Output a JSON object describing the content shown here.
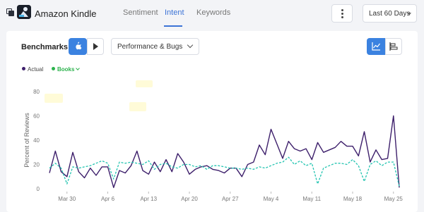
{
  "header": {
    "app_name": "Amazon Kindle",
    "tabs": [
      {
        "label": "Sentiment",
        "active": false
      },
      {
        "label": "Intent",
        "active": true
      },
      {
        "label": "Keywords",
        "active": false
      }
    ],
    "date_range": "Last 60 Days"
  },
  "toolbar": {
    "title": "Benchmarks",
    "category": "Performance & Bugs"
  },
  "legend": {
    "actual": "Actual",
    "books": "Books"
  },
  "colors": {
    "accent": "#3b73d6",
    "button_active": "#3b82e0",
    "actual_series": "#3d1f6b",
    "books_series": "#22c4b0",
    "books_legend": "#2bb24c"
  },
  "chart_data": {
    "type": "line",
    "ylabel": "Percent of Reviews",
    "ylim": [
      0,
      80
    ],
    "yticks": [
      0,
      20,
      40,
      60,
      80
    ],
    "grid": false,
    "x_tick_labels": [
      "Mar 30",
      "Apr 6",
      "Apr 13",
      "Apr 20",
      "Apr 27",
      "May 4",
      "May 11",
      "May 18",
      "May 25"
    ],
    "x": [
      "Mar 27",
      "Mar 28",
      "Mar 29",
      "Mar 30",
      "Mar 31",
      "Apr 1",
      "Apr 2",
      "Apr 3",
      "Apr 4",
      "Apr 5",
      "Apr 6",
      "Apr 7",
      "Apr 8",
      "Apr 9",
      "Apr 10",
      "Apr 11",
      "Apr 12",
      "Apr 13",
      "Apr 14",
      "Apr 15",
      "Apr 16",
      "Apr 17",
      "Apr 18",
      "Apr 19",
      "Apr 20",
      "Apr 21",
      "Apr 22",
      "Apr 23",
      "Apr 24",
      "Apr 25",
      "Apr 26",
      "Apr 27",
      "Apr 28",
      "Apr 29",
      "Apr 30",
      "May 1",
      "May 2",
      "May 3",
      "May 4",
      "May 5",
      "May 6",
      "May 7",
      "May 8",
      "May 9",
      "May 10",
      "May 11",
      "May 12",
      "May 13",
      "May 14",
      "May 15",
      "May 16",
      "May 17",
      "May 18",
      "May 19",
      "May 20",
      "May 21",
      "May 22",
      "May 23",
      "May 24",
      "May 25",
      "May 26"
    ],
    "series": [
      {
        "name": "Actual",
        "values": [
          13,
          31,
          14,
          10,
          30,
          14,
          9,
          17,
          11,
          18,
          18,
          1,
          15,
          13,
          19,
          31,
          15,
          12,
          22,
          14,
          24,
          14,
          29,
          22,
          12,
          16,
          18,
          19,
          16,
          15,
          13,
          17,
          17,
          10,
          20,
          22,
          36,
          28,
          49,
          37,
          25,
          39,
          33,
          31,
          33,
          24,
          38,
          30,
          32,
          34,
          39,
          35,
          35,
          27,
          47,
          22,
          32,
          24,
          25,
          60,
          1,
          1
        ],
        "color": "#3d1f6b"
      },
      {
        "name": "Books",
        "values": [
          17,
          21,
          17,
          4,
          18,
          17,
          18,
          19,
          21,
          23,
          21,
          8,
          22,
          21,
          22,
          21,
          20,
          23,
          16,
          20,
          21,
          18,
          17,
          20,
          20,
          18,
          19,
          16,
          19,
          19,
          18,
          17,
          17,
          16,
          17,
          16,
          18,
          17,
          19,
          21,
          22,
          26,
          20,
          23,
          19,
          21,
          4,
          17,
          19,
          21,
          21,
          20,
          24,
          19,
          6,
          20,
          23,
          19,
          22,
          22,
          2,
          2
        ],
        "color": "#22c4b0"
      }
    ]
  }
}
